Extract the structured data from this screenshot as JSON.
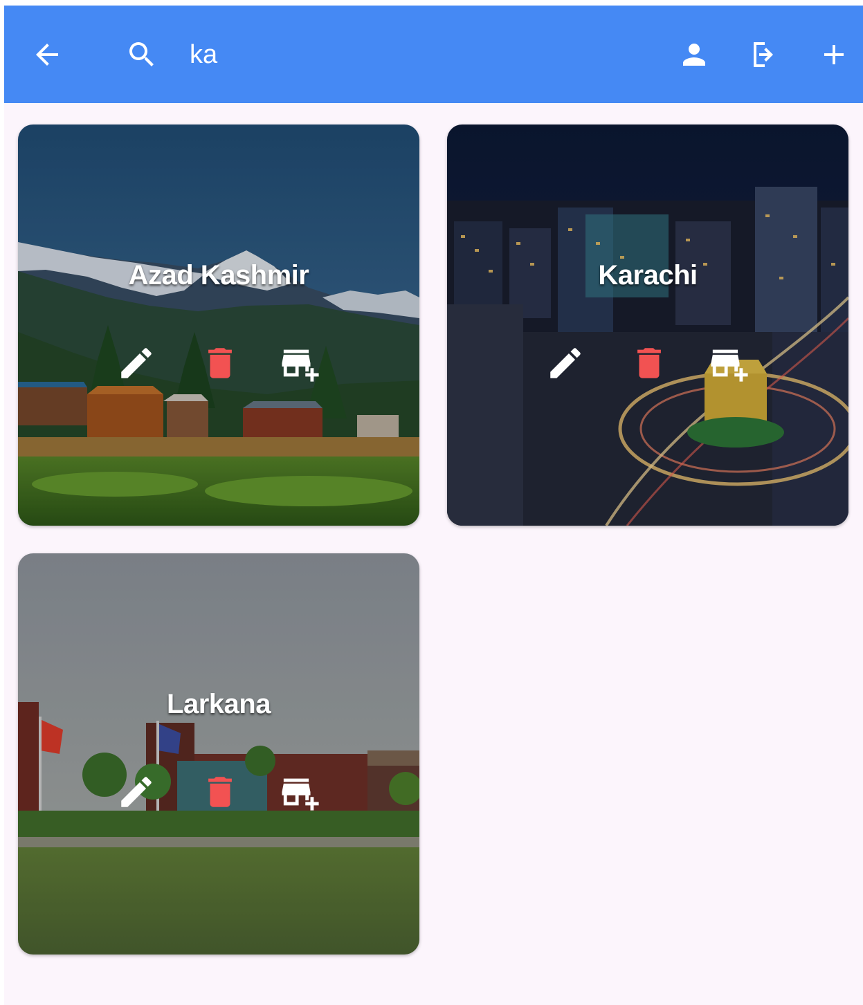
{
  "appbar": {
    "back_icon": "arrow-back-icon",
    "search_icon": "search-icon",
    "search_value": "ka",
    "profile_icon": "person-icon",
    "logout_icon": "logout-icon",
    "add_icon": "add-icon",
    "background_color": "#4589f4"
  },
  "cities": [
    {
      "name": "Azad Kashmir",
      "edit_icon": "pencil-icon",
      "delete_icon": "trash-icon",
      "add_store_icon": "add-business-icon"
    },
    {
      "name": "Karachi",
      "edit_icon": "pencil-icon",
      "delete_icon": "trash-icon",
      "add_store_icon": "add-business-icon"
    },
    {
      "name": "Larkana",
      "edit_icon": "pencil-icon",
      "delete_icon": "trash-icon",
      "add_store_icon": "add-business-icon"
    }
  ],
  "colors": {
    "page_background": "#fcf5fc",
    "delete_icon": "#f25252",
    "action_icons": "#ffffff"
  }
}
